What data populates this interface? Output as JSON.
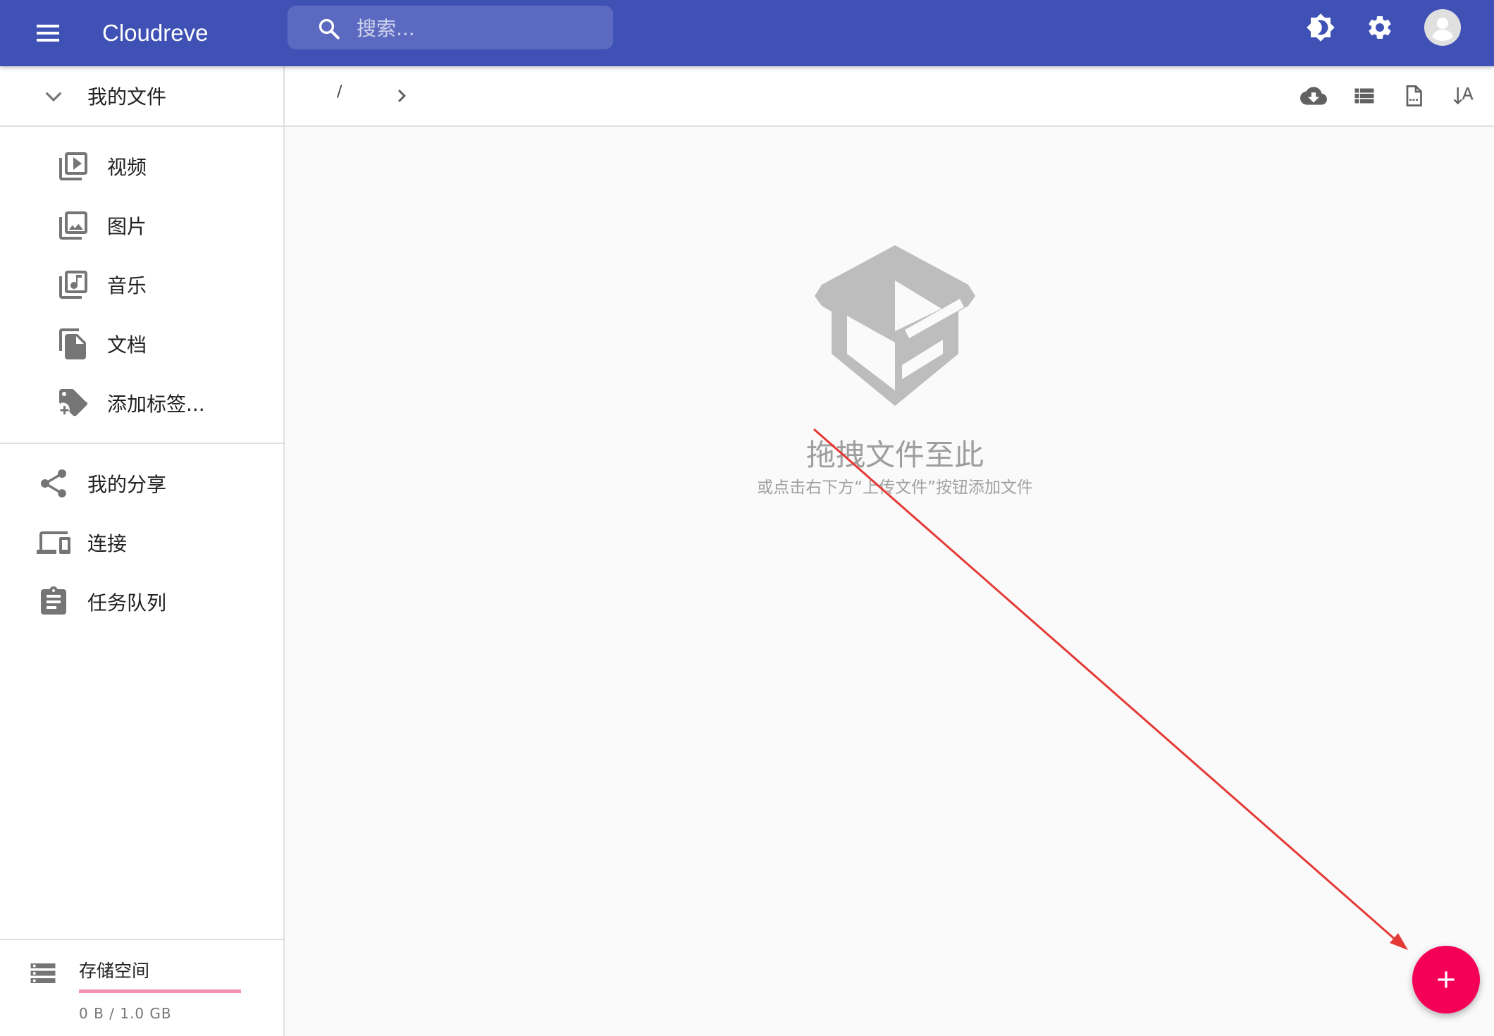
{
  "app": {
    "title": "Cloudreve"
  },
  "search": {
    "placeholder": "搜索..."
  },
  "header_icons": [
    "menu-icon",
    "brightness-icon",
    "settings-icon",
    "account-icon"
  ],
  "sidebar": {
    "my_files": "我的文件",
    "categories": [
      {
        "label": "视频",
        "icon": "video-library-icon"
      },
      {
        "label": "图片",
        "icon": "photo-library-icon"
      },
      {
        "label": "音乐",
        "icon": "music-library-icon"
      },
      {
        "label": "文档",
        "icon": "file-copy-icon"
      },
      {
        "label": "添加标签...",
        "icon": "add-tag-icon"
      }
    ],
    "links": [
      {
        "label": "我的分享",
        "icon": "share-icon"
      },
      {
        "label": "连接",
        "icon": "devices-icon"
      },
      {
        "label": "任务队列",
        "icon": "assignment-icon"
      }
    ],
    "storage": {
      "title": "存储空间",
      "usage": "0 B / 1.0 GB",
      "fraction": 1.0
    }
  },
  "breadcrumb": {
    "root": "/"
  },
  "toolbar_icons": [
    "cloud-download-icon",
    "view-list-icon",
    "file-icon",
    "sort-icon"
  ],
  "empty": {
    "title": "拖拽文件至此",
    "subtitle": "或点击右下方“上传文件”按钮添加文件"
  },
  "colors": {
    "primary": "#3f51b5",
    "accent": "#f50057",
    "annotation": "#e53935"
  }
}
